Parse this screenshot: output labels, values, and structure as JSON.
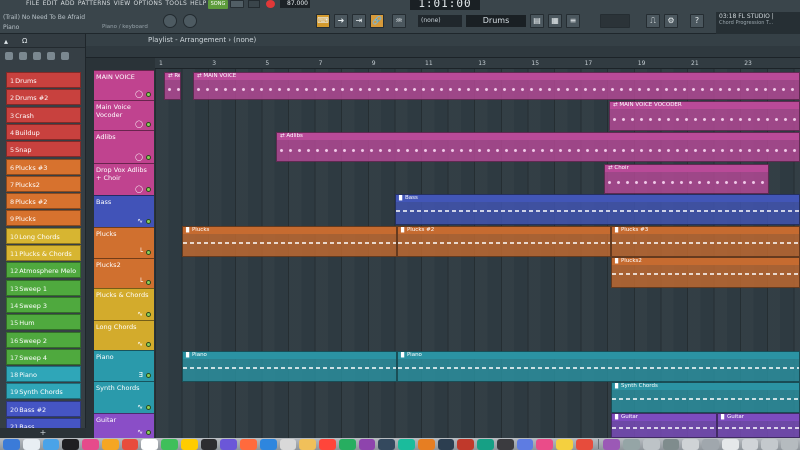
{
  "top": {
    "menu": [
      "FILE",
      "EDIT",
      "ADD",
      "PATTERNS",
      "VIEW",
      "OPTIONS",
      "TOOLS",
      "HELP"
    ],
    "hint_project": "(Trail) No Need To Be Afraid",
    "hint_tool": "Piano",
    "hint_sub": "Piano / keyboard",
    "song_label": "SONG",
    "tempo": "87.000",
    "time_display": "1:01:00",
    "pattern_select": "(none)",
    "drums_field": "Drums",
    "news_title": "03:18 FL STUDIO |",
    "news_sub": "Chord Progression T..."
  },
  "playlist": {
    "title": "Playlist - Arrangement › (none)",
    "bars": [
      "1",
      "3",
      "5",
      "7",
      "9",
      "11",
      "13",
      "15",
      "17",
      "19",
      "21",
      "23"
    ]
  },
  "channels": [
    {
      "num": "1",
      "label": "Drums",
      "color": "#c8413e"
    },
    {
      "num": "2",
      "label": "Drums #2",
      "color": "#c8413e"
    },
    {
      "num": "3",
      "label": "Crash",
      "color": "#c8413e"
    },
    {
      "num": "4",
      "label": "Buildup",
      "color": "#c8413e"
    },
    {
      "num": "5",
      "label": "Snap",
      "color": "#c8413e"
    },
    {
      "num": "6",
      "label": "Plucks #3",
      "color": "#d7722e"
    },
    {
      "num": "7",
      "label": "Plucks2",
      "color": "#d7722e"
    },
    {
      "num": "8",
      "label": "Plucks #2",
      "color": "#d7722e"
    },
    {
      "num": "9",
      "label": "Plucks",
      "color": "#d7722e"
    },
    {
      "num": "10",
      "label": "Long Chords",
      "color": "#d7b531"
    },
    {
      "num": "11",
      "label": "Plucks & Chords",
      "color": "#d7b531"
    },
    {
      "num": "12",
      "label": "Atmosphere Melo",
      "color": "#4fa93e"
    },
    {
      "num": "13",
      "label": "Sweep 1",
      "color": "#4fa93e"
    },
    {
      "num": "14",
      "label": "Sweep 3",
      "color": "#4fa93e"
    },
    {
      "num": "15",
      "label": "Hum",
      "color": "#4fa93e"
    },
    {
      "num": "16",
      "label": "Sweep 2",
      "color": "#4fa93e"
    },
    {
      "num": "17",
      "label": "Sweep 4",
      "color": "#4fa93e"
    },
    {
      "num": "18",
      "label": "Piano",
      "color": "#2fa6b8"
    },
    {
      "num": "19",
      "label": "Synth Chords",
      "color": "#2fa6b8"
    },
    {
      "num": "20",
      "label": "Bass #2",
      "color": "#4555c4"
    },
    {
      "num": "21",
      "label": "Bass",
      "color": "#4555c4"
    }
  ],
  "tracks": [
    {
      "label": "MAIN VOICE",
      "color": "#c0438f",
      "glyph": "◯"
    },
    {
      "label": "Main Voice Vocoder",
      "color": "#c0438f",
      "glyph": "◯"
    },
    {
      "label": "Adlibs",
      "color": "#c0438f",
      "glyph": "◯"
    },
    {
      "label": "Drop Vox Adlibs + Choir",
      "color": "#c0438f",
      "glyph": "◯"
    },
    {
      "label": "Bass",
      "color": "#4153b8",
      "glyph": "∿"
    },
    {
      "label": "Plucks",
      "color": "#d0702f",
      "glyph": "└"
    },
    {
      "label": "Plucks2",
      "color": "#d0702f",
      "glyph": "└"
    },
    {
      "label": "Plucks & Chords",
      "color": "#d3ab2c",
      "glyph": "∿"
    },
    {
      "label": "Long Chords",
      "color": "#d3ab2c",
      "glyph": "∿"
    },
    {
      "label": "Piano",
      "color": "#2a9aab",
      "glyph": "Ǝ"
    },
    {
      "label": "Synth Chords",
      "color": "#2a9aab",
      "glyph": "∿"
    },
    {
      "label": "Guitar",
      "color": "#8a4ec7",
      "glyph": "∿"
    }
  ],
  "clips": [
    {
      "label": "⇄ Re",
      "color": "#b94a98",
      "kind": "wave"
    },
    {
      "label": "⇄ MAIN VOICE",
      "color": "#b94a98",
      "kind": "wave"
    },
    {
      "label": "⇄ MAIN VOICE VOCODER",
      "color": "#b94a98",
      "kind": "wave"
    },
    {
      "label": "⇄ Adlibs",
      "color": "#b94a98",
      "kind": "wave"
    },
    {
      "label": "⇄ Choir",
      "color": "#b94a98",
      "kind": "wave"
    },
    {
      "label": "▊ Bass",
      "color": "#4256b7",
      "kind": "notes"
    },
    {
      "label": "▊ Plucks",
      "color": "#c66b30",
      "kind": "notes"
    },
    {
      "label": "▊ Plucks #2",
      "color": "#c66b30",
      "kind": "notes"
    },
    {
      "label": "▊ Plucks #3",
      "color": "#c66b30",
      "kind": "notes"
    },
    {
      "label": "▊ Plucks2",
      "color": "#c66b30",
      "kind": "notes"
    },
    {
      "label": "▊ Piano",
      "color": "#2b93a3",
      "kind": "notes"
    },
    {
      "label": "▊ Piano",
      "color": "#2b93a3",
      "kind": "notes"
    },
    {
      "label": "▊ Synth Chords",
      "color": "#2b93a3",
      "kind": "notes"
    },
    {
      "label": "▊ Guitar",
      "color": "#7d4cbf",
      "kind": "notes"
    },
    {
      "label": "▊ Guitar",
      "color": "#7d4cbf",
      "kind": "notes"
    }
  ],
  "browser_add_label": "+"
}
